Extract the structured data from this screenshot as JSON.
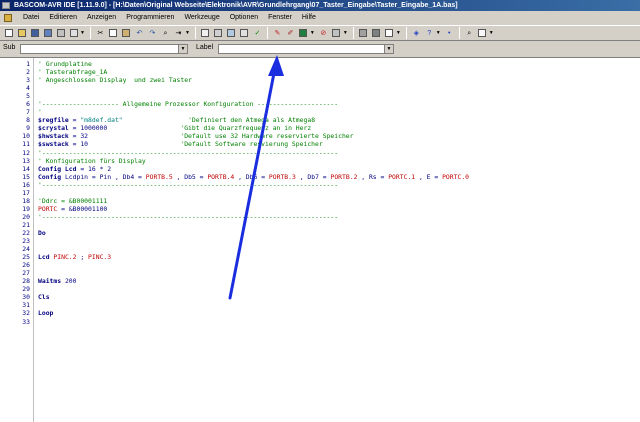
{
  "window": {
    "title": "BASCOM-AVR IDE [1.11.9.0] - [H:\\Daten\\Original Webseite\\Elektronik\\AVR\\Grundlehrgang\\07_Taster_Eingabe\\Taster_Eingabe_1A.bas]"
  },
  "menu": [
    "Datei",
    "Editieren",
    "Anzeigen",
    "Programmieren",
    "Werkzeuge",
    "Optionen",
    "Fenster",
    "Hilfe"
  ],
  "subbar": {
    "sub_label": "Sub",
    "label_label": "Label",
    "sub_value": "",
    "label_value": ""
  },
  "colors": {
    "comment": "#008000",
    "keyword": "#000080",
    "string": "#008080",
    "port": "#c00000",
    "arrow": "#1a2ee0"
  },
  "code": [
    {
      "n": "1",
      "s": [
        {
          "c": "comment",
          "t": "' Grundplatine"
        }
      ]
    },
    {
      "n": "2",
      "s": [
        {
          "c": "comment",
          "t": "' Tasterabfrage_1A"
        }
      ]
    },
    {
      "n": "3",
      "s": [
        {
          "c": "comment",
          "t": "' Angeschlossen Display  und zwei Taster"
        }
      ]
    },
    {
      "n": "4",
      "s": []
    },
    {
      "n": "5",
      "s": []
    },
    {
      "n": "6",
      "s": [
        {
          "c": "comment",
          "t": "'-------------------- Allgemeine Prozessor Konfiguration ---------------------"
        }
      ]
    },
    {
      "n": "7",
      "s": [
        {
          "c": "comment",
          "t": "'"
        }
      ]
    },
    {
      "n": "8",
      "s": [
        {
          "c": "kw",
          "t": "$regfile"
        },
        {
          "c": "plain",
          "t": " = "
        },
        {
          "c": "str",
          "t": "\"m8def.dat\""
        },
        {
          "c": "plain",
          "t": "                 "
        },
        {
          "c": "comment",
          "t": "'Definiert den Atmega als Atmega8"
        }
      ]
    },
    {
      "n": "9",
      "s": [
        {
          "c": "kw",
          "t": "$crystal"
        },
        {
          "c": "plain",
          "t": " = 1000000                   "
        },
        {
          "c": "comment",
          "t": "'Gibt die Quarzfrequenz an in Herz"
        }
      ]
    },
    {
      "n": "10",
      "s": [
        {
          "c": "kw",
          "t": "$hwstack"
        },
        {
          "c": "plain",
          "t": " = 32                        "
        },
        {
          "c": "comment",
          "t": "'Default use 32 Hardware reservierte Speicher"
        }
      ]
    },
    {
      "n": "11",
      "s": [
        {
          "c": "kw",
          "t": "$swstack"
        },
        {
          "c": "plain",
          "t": " = 10                        "
        },
        {
          "c": "comment",
          "t": "'Default Software resvierung Speicher"
        }
      ]
    },
    {
      "n": "12",
      "s": [
        {
          "c": "comment",
          "t": "'-----------------------------------------------------------------------------"
        }
      ]
    },
    {
      "n": "13",
      "s": [
        {
          "c": "comment",
          "t": "' Konfiguration fürs Display"
        }
      ]
    },
    {
      "n": "14",
      "s": [
        {
          "c": "kw",
          "t": "Config Lcd"
        },
        {
          "c": "plain",
          "t": " = 16 * 2"
        }
      ]
    },
    {
      "n": "15",
      "s": [
        {
          "c": "kw",
          "t": "Config"
        },
        {
          "c": "plain",
          "t": " Lcdpin = Pin , Db4 = "
        },
        {
          "c": "port",
          "t": "PORTB.5"
        },
        {
          "c": "plain",
          "t": " , Db5 = "
        },
        {
          "c": "port",
          "t": "PORTB.4"
        },
        {
          "c": "plain",
          "t": " , Db6 = "
        },
        {
          "c": "port",
          "t": "PORTB.3"
        },
        {
          "c": "plain",
          "t": " , Db7 = "
        },
        {
          "c": "port",
          "t": "PORTB.2"
        },
        {
          "c": "plain",
          "t": " , Rs = "
        },
        {
          "c": "port",
          "t": "PORTC.1"
        },
        {
          "c": "plain",
          "t": " , E = "
        },
        {
          "c": "port",
          "t": "PORTC.0"
        }
      ]
    },
    {
      "n": "16",
      "s": [
        {
          "c": "comment",
          "t": "'-----------------------------------------------------------------------------"
        }
      ]
    },
    {
      "n": "17",
      "s": []
    },
    {
      "n": "18",
      "s": [
        {
          "c": "comment",
          "t": "'Ddrc = &B00001111"
        }
      ]
    },
    {
      "n": "19",
      "s": [
        {
          "c": "port",
          "t": "PORTC"
        },
        {
          "c": "plain",
          "t": " = &B00001100"
        }
      ]
    },
    {
      "n": "20",
      "s": [
        {
          "c": "comment",
          "t": "'-----------------------------------------------------------------------------"
        }
      ]
    },
    {
      "n": "21",
      "s": []
    },
    {
      "n": "22",
      "s": [
        {
          "c": "kw",
          "t": "Do"
        }
      ]
    },
    {
      "n": "23",
      "s": []
    },
    {
      "n": "24",
      "s": []
    },
    {
      "n": "25",
      "s": [
        {
          "c": "kw",
          "t": "Lcd"
        },
        {
          "c": "plain",
          "t": " "
        },
        {
          "c": "port",
          "t": "PINC.2"
        },
        {
          "c": "plain",
          "t": " ; "
        },
        {
          "c": "port",
          "t": "PINC.3"
        }
      ]
    },
    {
      "n": "26",
      "s": []
    },
    {
      "n": "27",
      "s": []
    },
    {
      "n": "28",
      "s": [
        {
          "c": "kw",
          "t": "Waitms"
        },
        {
          "c": "plain",
          "t": " 200"
        }
      ]
    },
    {
      "n": "29",
      "s": []
    },
    {
      "n": "30",
      "s": [
        {
          "c": "kw",
          "t": "Cls"
        }
      ]
    },
    {
      "n": "31",
      "s": []
    },
    {
      "n": "32",
      "s": [
        {
          "c": "kw",
          "t": "Loop"
        }
      ]
    },
    {
      "n": "33",
      "s": []
    }
  ],
  "toolbar_icons": [
    "new-file-icon",
    "open-file-icon",
    "save-icon",
    "save-all-icon",
    "print-icon",
    "print-preview-icon",
    "cut-icon",
    "copy-icon",
    "paste-icon",
    "undo-icon",
    "redo-icon",
    "find-icon",
    "indent-icon",
    "outdent-icon",
    "compile-icon",
    "syntax-check-icon",
    "program-chip-icon",
    "simulate-icon",
    "terminal-icon",
    "lcd-designer-icon",
    "lib-manager-icon",
    "options-icon",
    "help-icon",
    "info-icon",
    "bookmark-icon",
    "stop-icon"
  ]
}
